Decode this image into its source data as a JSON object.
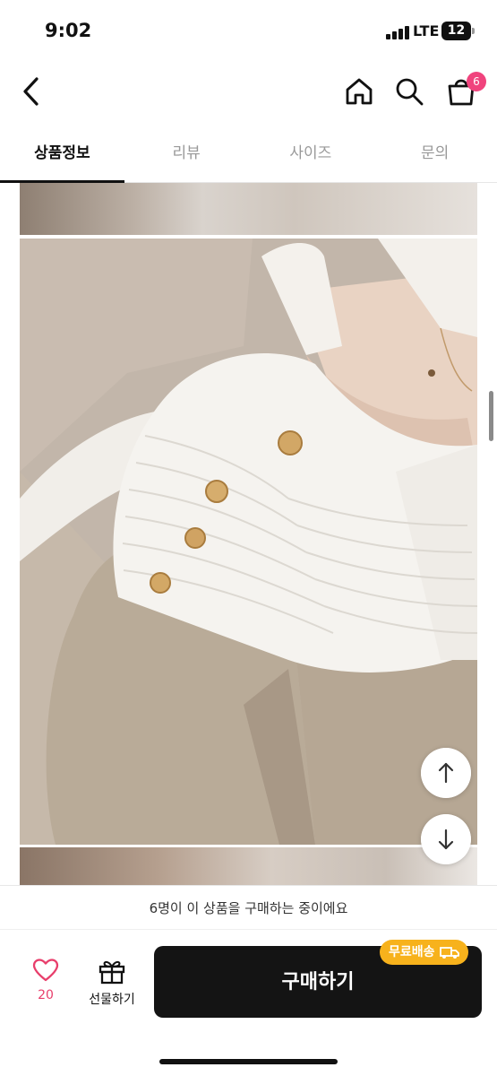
{
  "status_bar": {
    "time": "9:02",
    "network": "LTE",
    "battery": "12"
  },
  "nav": {
    "icons": [
      "back-chevron-icon",
      "home-icon",
      "search-icon",
      "shopping-bag-icon"
    ],
    "cart_count": "6"
  },
  "tabs": [
    {
      "label": "상품정보",
      "active": true
    },
    {
      "label": "리뷰",
      "active": false
    },
    {
      "label": "사이즈",
      "active": false
    },
    {
      "label": "문의",
      "active": false
    }
  ],
  "floating": {
    "up_icon": "arrow-up-icon",
    "down_icon": "arrow-down-icon"
  },
  "notice": {
    "text": "6명이 이 상품을 구매하는 중이에요"
  },
  "actions": {
    "like_count": "20",
    "gift_label": "선물하기",
    "buy_label": "구매하기",
    "free_shipping_label": "무료배송"
  },
  "colors": {
    "accent": "#f0437d",
    "buy_button": "#141414",
    "free_shipping": "#f7b21c",
    "like": "#e83e6b"
  }
}
